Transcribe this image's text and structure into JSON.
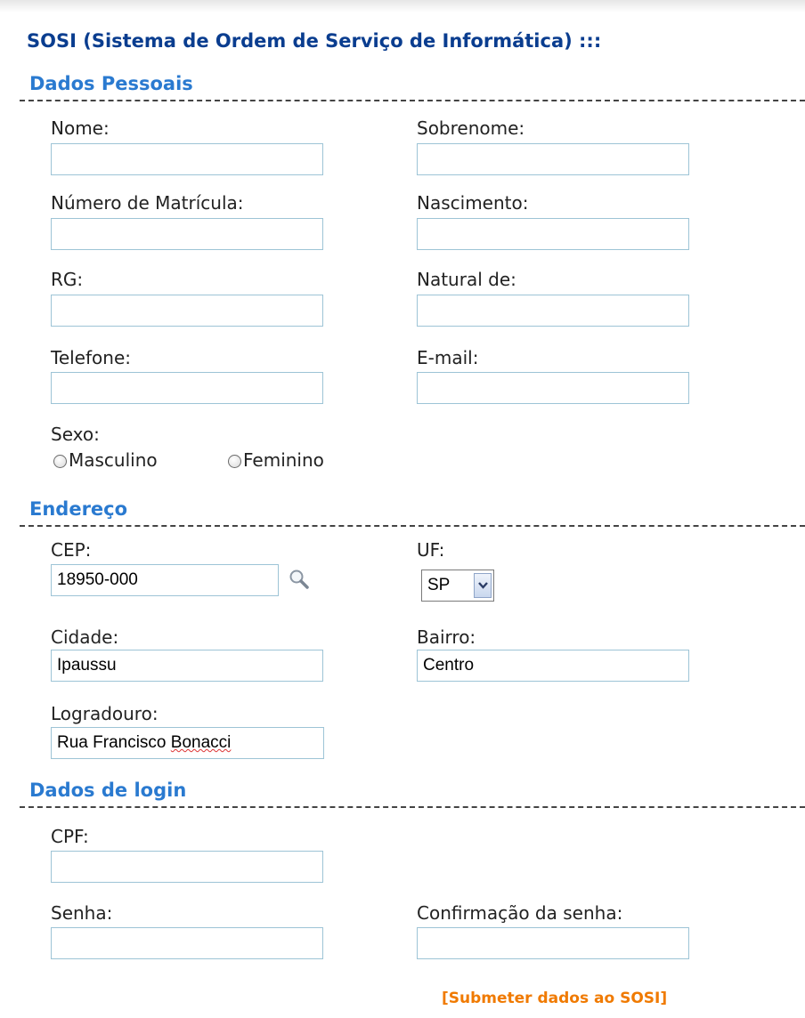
{
  "page": {
    "title": "SOSI (Sistema de Ordem de Serviço de Informática) :::"
  },
  "personal": {
    "title": "Dados Pessoais",
    "nome_label": "Nome:",
    "nome_value": "",
    "sobrenome_label": "Sobrenome:",
    "sobrenome_value": "",
    "matricula_label": "Número de Matrícula:",
    "matricula_value": "",
    "nascimento_label": "Nascimento:",
    "nascimento_value": "",
    "rg_label": "RG:",
    "rg_value": "",
    "natural_label": "Natural de:",
    "natural_value": "",
    "telefone_label": "Telefone:",
    "telefone_value": "",
    "email_label": "E-mail:",
    "email_value": "",
    "sexo_label": "Sexo:",
    "sexo_options": [
      "Masculino",
      "Feminino"
    ]
  },
  "address": {
    "title": "Endereço",
    "cep_label": "CEP:",
    "cep_value": "18950-000",
    "uf_label": "UF:",
    "uf_value": "SP",
    "cidade_label": "Cidade:",
    "cidade_value": "Ipaussu",
    "bairro_label": "Bairro:",
    "bairro_value": "Centro",
    "logradouro_label": "Logradouro:",
    "logradouro_value_part1": "Rua Francisco ",
    "logradouro_value_part2": "Bonacci"
  },
  "login": {
    "title": "Dados de login",
    "cpf_label": "CPF:",
    "cpf_value": "",
    "senha_label": "Senha:",
    "senha_value": "",
    "confirm_label": "Confirmação da senha:",
    "confirm_value": ""
  },
  "actions": {
    "submit_label": "[Submeter dados ao SOSI]"
  },
  "icons": {
    "search": "magnifier-icon",
    "dropdown": "chevron-down-icon"
  },
  "colors": {
    "title": "#0a3d8f",
    "section": "#2a7ad0",
    "field_border": "#9dc4d6",
    "submit": "#f07a00"
  }
}
